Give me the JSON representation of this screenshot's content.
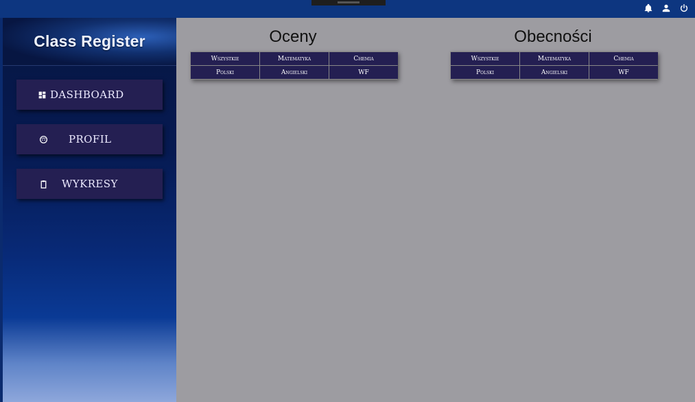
{
  "sidebar": {
    "brand_title": "Class Register",
    "nav": [
      {
        "label": "DASHBOARD",
        "icon": "dashboard-icon"
      },
      {
        "label": "PROFIL",
        "icon": "face-icon"
      },
      {
        "label": "WYKRESY",
        "icon": "clipboard-icon"
      }
    ]
  },
  "topbar": {
    "icons": [
      "bell-icon",
      "user-icon",
      "power-icon"
    ]
  },
  "grades": {
    "title": "Oceny",
    "subjects": [
      "Wszystkie",
      "Matematyka",
      "Chemia",
      "Polski",
      "Angielski",
      "WF"
    ]
  },
  "attendance": {
    "title": "Obecności",
    "subjects": [
      "Wszystkie",
      "Matematyka",
      "Chemia",
      "Polski",
      "Angielski",
      "WF"
    ]
  },
  "colors": {
    "topbar": "#0d3680",
    "button_bg": "#241f52",
    "content_bg": "#9d9ca1"
  }
}
